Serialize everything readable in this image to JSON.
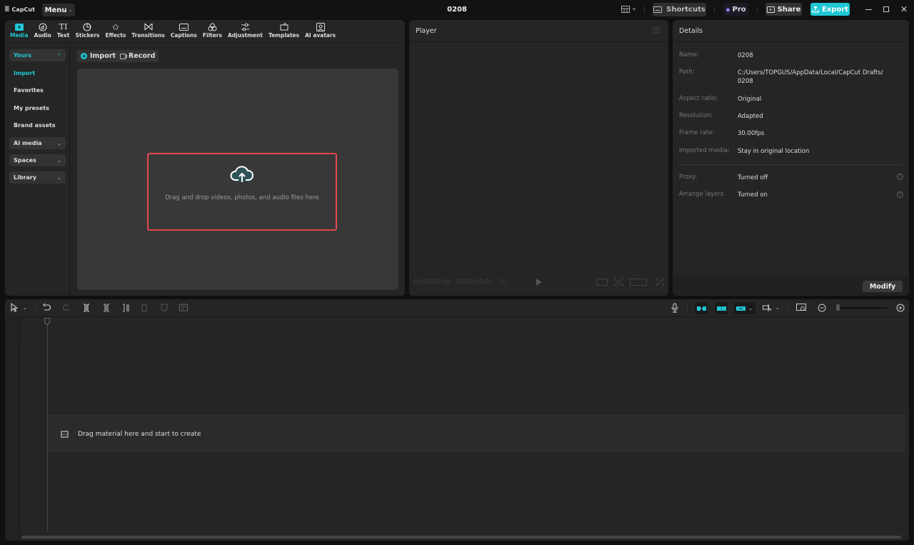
{
  "app": {
    "name": "CapCut",
    "menu_label": "Menu",
    "project_title": "0208"
  },
  "titlebar": {
    "shortcuts_label": "Shortcuts",
    "pro_label": "Pro",
    "share_label": "Share",
    "export_label": "Export",
    "accent_color": "#1fc7d4"
  },
  "media_tabs": [
    {
      "label": "Media",
      "icon": "media-icon",
      "active": true
    },
    {
      "label": "Audio",
      "icon": "audio-icon"
    },
    {
      "label": "Text",
      "icon": "text-icon"
    },
    {
      "label": "Stickers",
      "icon": "stickers-icon"
    },
    {
      "label": "Effects",
      "icon": "effects-icon"
    },
    {
      "label": "Transitions",
      "icon": "transitions-icon"
    },
    {
      "label": "Captions",
      "icon": "captions-icon"
    },
    {
      "label": "Filters",
      "icon": "filters-icon"
    },
    {
      "label": "Adjustment",
      "icon": "adjustment-icon"
    },
    {
      "label": "Templates",
      "icon": "templates-icon"
    },
    {
      "label": "AI avatars",
      "icon": "ai-avatars-icon"
    }
  ],
  "leftnav": {
    "yours": "Yours",
    "items": [
      "Import",
      "Favorites",
      "My presets",
      "Brand assets"
    ],
    "groups": [
      "AI media",
      "Spaces",
      "Library"
    ]
  },
  "media": {
    "import_label": "Import",
    "record_label": "Record",
    "dropzone_text": "Drag and drop videos, photos, and audio files here"
  },
  "player": {
    "title": "Player",
    "current_time": "00:00:00:00",
    "total_time": "00:00:00:00"
  },
  "details": {
    "title": "Details",
    "rows": [
      {
        "label": "Name:",
        "value": "0208"
      },
      {
        "label": "Path:",
        "value": "C:/Users/TOPGUS/AppData/Local/CapCut Drafts/",
        "value2": "0208"
      },
      {
        "label": "Aspect ratio:",
        "value": "Original"
      },
      {
        "label": "Resolution:",
        "value": "Adapted"
      },
      {
        "label": "Frame rate:",
        "value": "30.00fps"
      },
      {
        "label": "Imported media:",
        "value": "Stay in original location"
      }
    ],
    "settings": [
      {
        "label": "Proxy:",
        "value": "Turned off"
      },
      {
        "label": "Arrange layers",
        "value": "Turned on"
      }
    ],
    "modify_label": "Modify"
  },
  "timeline": {
    "drop_text": "Drag material here and start to create"
  }
}
